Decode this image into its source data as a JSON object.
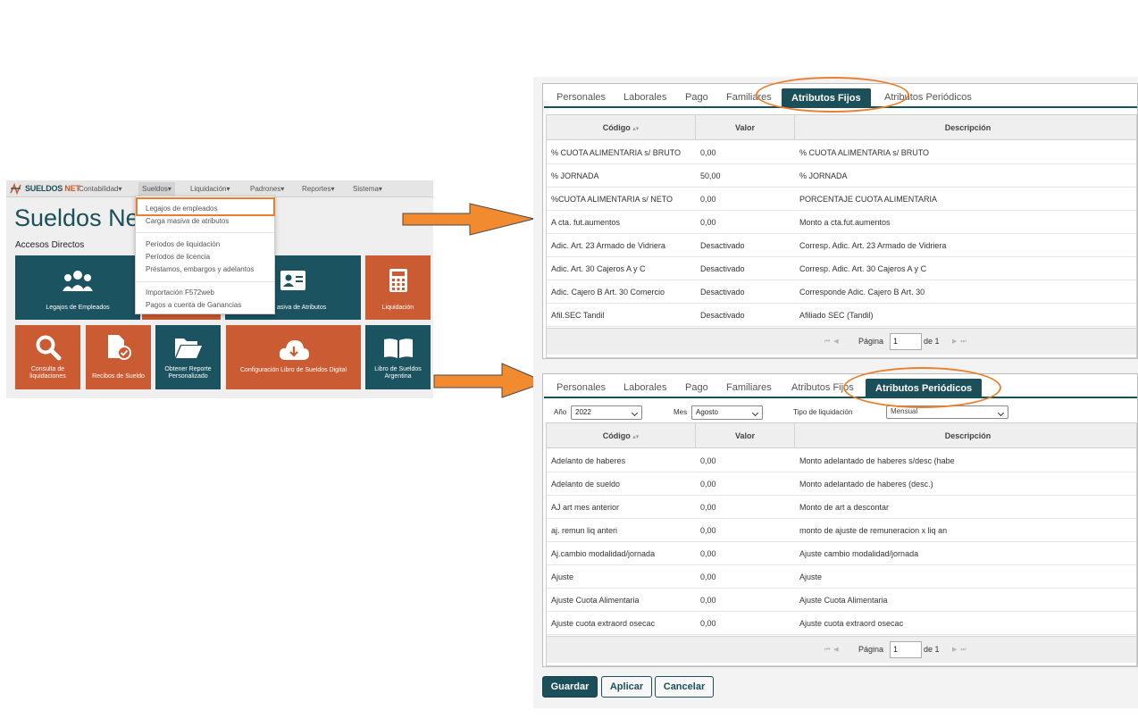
{
  "left_app": {
    "logo_sueldos": "SUELDOS",
    "logo_net": "NET",
    "nav": [
      "Contabilidad",
      "Sueldos",
      "Liquidación",
      "Padrones",
      "Reportes",
      "Sistema"
    ],
    "title_main": "Sueldos Ne",
    "title_tail": "t",
    "accesos_label": "Accesos Directos",
    "dropdown": [
      "Legajos de empleados",
      "Carga masiva de atributos",
      "Períodos de liquidación",
      "Períodos de licencia",
      "Préstamos, embargos y adelantos",
      "Importación F572web",
      "Pagos a cuenta de Ganancias"
    ],
    "tiles": [
      "Legajos de Empleados",
      "asiva de Atributos",
      "Liquidación",
      "Consulta de liquidaciones",
      "Recibos de Sueldo",
      "Obtener Reporte Personalizado",
      "Configuración Libro de Sueldos Digital",
      "Libro de Sueldos Argentina"
    ]
  },
  "tabs": [
    "Personales",
    "Laborales",
    "Pago",
    "Familiares",
    "Atributos Fijos",
    "Atributos Periódicos"
  ],
  "grid_headers": {
    "codigo": "Código",
    "valor": "Valor",
    "descripcion": "Descripción"
  },
  "fixed_rows": [
    {
      "codigo": "% CUOTA ALIMENTARIA s/ BRUTO",
      "valor": "0,00",
      "descripcion": "% CUOTA ALIMENTARIA s/ BRUTO"
    },
    {
      "codigo": "% JORNADA",
      "valor": "50,00",
      "descripcion": "% JORNADA"
    },
    {
      "codigo": "%CUOTA ALIMENTARIA s/ NETO",
      "valor": "0,00",
      "descripcion": "PORCENTAJE CUOTA ALIMENTARIA"
    },
    {
      "codigo": "A cta. fut.aumentos",
      "valor": "0,00",
      "descripcion": "Monto a cta.fut.aumentos"
    },
    {
      "codigo": "Adic. Art. 23  Armado de Vidriera",
      "valor": "Desactivado",
      "descripcion": "Corresp. Adic. Art. 23  Armado de Vidriera"
    },
    {
      "codigo": "Adic. Art. 30 Cajeros A y C",
      "valor": "Desactivado",
      "descripcion": "Corresp. Adic. Art. 30 Cajeros A y C"
    },
    {
      "codigo": "Adic. Cajero B Art. 30 Comercio",
      "valor": "Desactivado",
      "descripcion": "Corresponde Adic. Cajero B Art. 30"
    },
    {
      "codigo": "Afil.SEC Tandil",
      "valor": "Desactivado",
      "descripcion": "Afiliado SEC (Tandil)"
    }
  ],
  "periodic_filters": {
    "anio_label": "Año",
    "anio_value": "2022",
    "mes_label": "Mes",
    "mes_value": "Agosto",
    "tipo_label": "Tipo de liquidación",
    "tipo_value": "Mensual"
  },
  "periodic_rows": [
    {
      "codigo": "Adelanto de haberes",
      "valor": "0,00",
      "descripcion": "Monto adelantado de haberes s/desc (habe"
    },
    {
      "codigo": "Adelanto de sueldo",
      "valor": "0,00",
      "descripcion": "Monto adelantado de haberes (desc.)"
    },
    {
      "codigo": "AJ art mes anterior",
      "valor": "0,00",
      "descripcion": "Monto de art a descontar"
    },
    {
      "codigo": "aj. remun liq anteri",
      "valor": "0,00",
      "descripcion": "monto de ajuste de remuneracion x liq an"
    },
    {
      "codigo": "Aj.cambio modalidad/jornada",
      "valor": "0,00",
      "descripcion": "Ajuste cambio modalidad/jornada"
    },
    {
      "codigo": "Ajuste",
      "valor": "0,00",
      "descripcion": "Ajuste"
    },
    {
      "codigo": "Ajuste Cuota Alimentaria",
      "valor": "0,00",
      "descripcion": "Ajuste Cuota Alimentaria"
    },
    {
      "codigo": "Ajuste cuota extraord osecac",
      "valor": "0,00",
      "descripcion": "Ajuste cuota extraord osecac"
    }
  ],
  "pager": {
    "label": "Página",
    "page": "1",
    "of": "de 1"
  },
  "buttons": {
    "guardar": "Guardar",
    "aplicar": "Aplicar",
    "cancelar": "Cancelar"
  },
  "colors": {
    "teal": "#1b4f5a",
    "orange": "#cb5b32",
    "highlight": "#e8802e"
  }
}
